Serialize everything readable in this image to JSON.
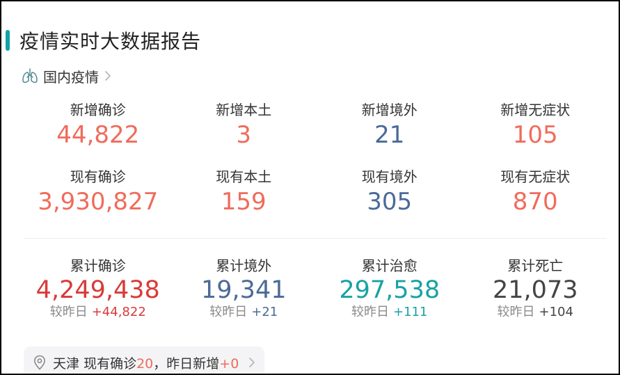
{
  "header": {
    "title": "疫情实时大数据报告",
    "accent_color": "#10a3a6"
  },
  "section": {
    "label": "国内疫情",
    "icon": "lungs-icon"
  },
  "colors": {
    "red": "#f06b5b",
    "blue": "#4a6a97",
    "dark_red": "#d93a3a",
    "teal": "#17a2a5",
    "gray_dark": "#444444"
  },
  "row1": [
    {
      "label": "新增确诊",
      "value": "44,822"
    },
    {
      "label": "新增本土",
      "value": "3"
    },
    {
      "label": "新增境外",
      "value": "21"
    },
    {
      "label": "新增无症状",
      "value": "105"
    }
  ],
  "row2": [
    {
      "label": "现有确诊",
      "value": "3,930,827"
    },
    {
      "label": "现有本土",
      "value": "159"
    },
    {
      "label": "现有境外",
      "value": "305"
    },
    {
      "label": "现有无症状",
      "value": "870"
    }
  ],
  "row3": [
    {
      "label": "累计确诊",
      "value": "4,249,438",
      "delta_prefix": "较昨日",
      "delta": "+44,822"
    },
    {
      "label": "累计境外",
      "value": "19,341",
      "delta_prefix": "较昨日",
      "delta": "+21"
    },
    {
      "label": "累计治愈",
      "value": "297,538",
      "delta_prefix": "较昨日",
      "delta": "+111"
    },
    {
      "label": "累计死亡",
      "value": "21,073",
      "delta_prefix": "较昨日",
      "delta": "+104"
    }
  ],
  "city": {
    "name": "天津",
    "current_label": "现有确诊",
    "current_value": "20",
    "separator": "，",
    "new_label": "昨日新增",
    "new_value": "+0",
    "icon": "location-pin-icon"
  }
}
